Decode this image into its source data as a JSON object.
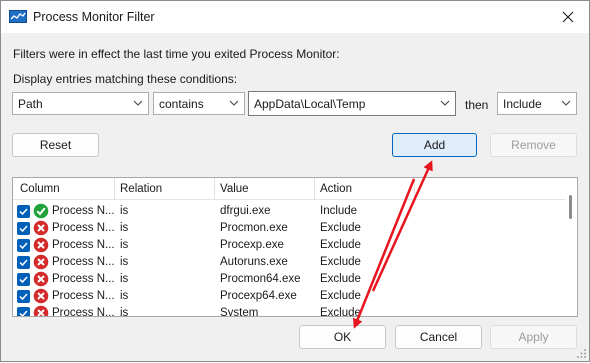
{
  "window": {
    "title": "Process Monitor Filter",
    "icons": {
      "app": "process-monitor-icon",
      "close": "close-icon"
    }
  },
  "intro_text": "Filters were in effect the last time you exited Process Monitor:",
  "conditions_label": "Display entries matching these conditions:",
  "filter_row": {
    "column_value": "Path",
    "relation_value": "contains",
    "value_text": "AppData\\Local\\Temp",
    "then_label": "then",
    "action_value": "Include"
  },
  "buttons": {
    "reset": "Reset",
    "add": "Add",
    "remove": "Remove",
    "ok": "OK",
    "cancel": "Cancel",
    "apply": "Apply"
  },
  "list": {
    "columns": [
      "Column",
      "Relation",
      "Value",
      "Action"
    ],
    "rows": [
      {
        "column": "Process N...",
        "relation": "is",
        "value": "dfrgui.exe",
        "action": "Include",
        "status": "include-check-icon"
      },
      {
        "column": "Process N...",
        "relation": "is",
        "value": "Procmon.exe",
        "action": "Exclude",
        "status": "exclude-x-icon"
      },
      {
        "column": "Process N...",
        "relation": "is",
        "value": "Procexp.exe",
        "action": "Exclude",
        "status": "exclude-x-icon"
      },
      {
        "column": "Process N...",
        "relation": "is",
        "value": "Autoruns.exe",
        "action": "Exclude",
        "status": "exclude-x-icon"
      },
      {
        "column": "Process N...",
        "relation": "is",
        "value": "Procmon64.exe",
        "action": "Exclude",
        "status": "exclude-x-icon"
      },
      {
        "column": "Process N...",
        "relation": "is",
        "value": "Procexp64.exe",
        "action": "Exclude",
        "status": "exclude-x-icon"
      },
      {
        "column": "Process N...",
        "relation": "is",
        "value": "System",
        "action": "Exclude",
        "status": "exclude-x-icon"
      }
    ]
  },
  "colors": {
    "accent": "#0067c0",
    "checkbox": "#005fb8",
    "include_green": "#1fa33a",
    "exclude_red": "#d42a2a",
    "annotation_red": "#e8141e"
  }
}
